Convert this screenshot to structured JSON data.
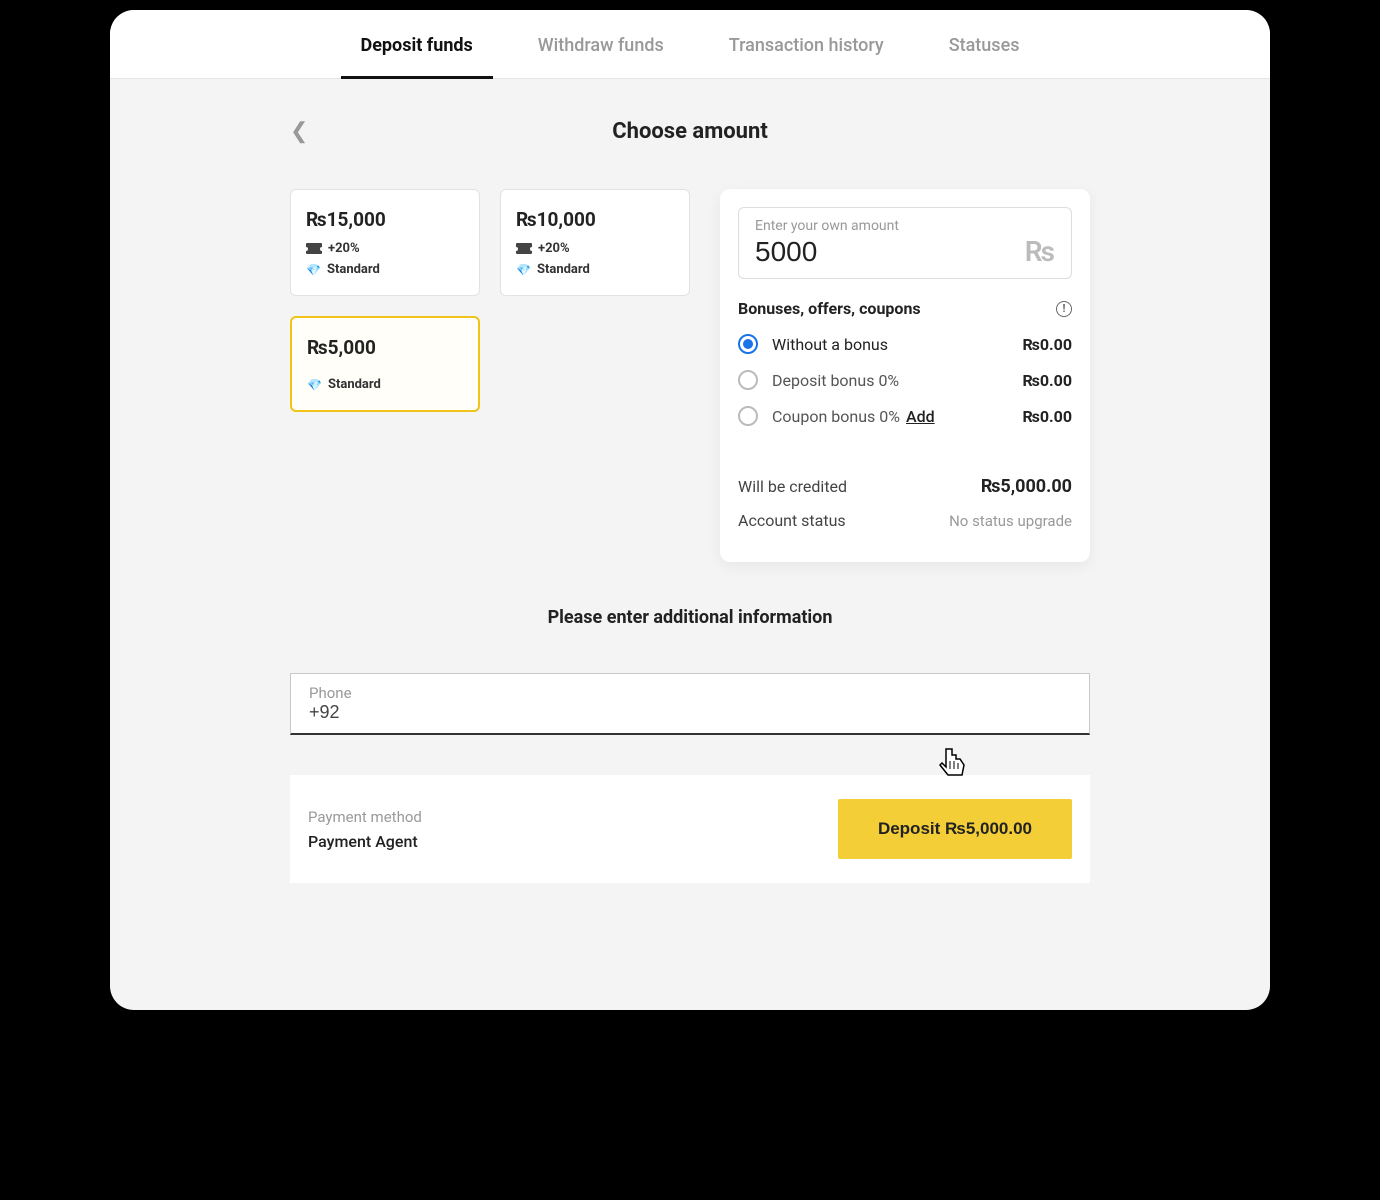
{
  "tabs": [
    {
      "label": "Deposit funds",
      "active": true
    },
    {
      "label": "Withdraw funds",
      "active": false
    },
    {
      "label": "Transaction history",
      "active": false
    },
    {
      "label": "Statuses",
      "active": false
    }
  ],
  "page_title": "Choose amount",
  "currency_symbol": "₨",
  "amount_options": [
    {
      "amount": "₨15,000",
      "bonus": "+20%",
      "tier": "Standard",
      "selected": false
    },
    {
      "amount": "₨10,000",
      "bonus": "+20%",
      "tier": "Standard",
      "selected": false
    },
    {
      "amount": "₨5,000",
      "bonus": null,
      "tier": "Standard",
      "selected": true
    }
  ],
  "amount_input": {
    "label": "Enter your own amount",
    "value": "5000",
    "suffix": "₨"
  },
  "bonuses": {
    "title": "Bonuses, offers, coupons",
    "options": [
      {
        "label": "Without a bonus",
        "amount": "₨0.00",
        "checked": true,
        "add": false
      },
      {
        "label": "Deposit bonus 0%",
        "amount": "₨0.00",
        "checked": false,
        "add": false
      },
      {
        "label": "Coupon bonus 0%",
        "amount": "₨0.00",
        "checked": false,
        "add": true
      }
    ],
    "add_label": "Add"
  },
  "summary": {
    "credited_label": "Will be credited",
    "credited_value": "₨5,000.00",
    "status_label": "Account status",
    "status_value": "No status upgrade"
  },
  "additional_title": "Please enter additional information",
  "phone": {
    "label": "Phone",
    "value": "+92 "
  },
  "payment": {
    "label": "Payment method",
    "value": "Payment Agent"
  },
  "deposit_button": "Deposit ₨5,000.00"
}
